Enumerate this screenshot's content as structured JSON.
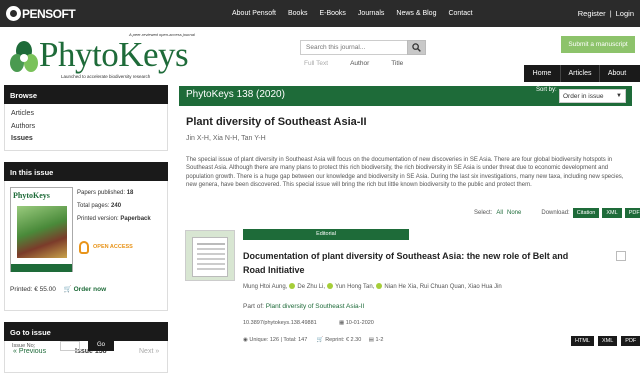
{
  "topbar": {
    "brand": "PENSOFT",
    "nav": [
      "About Pensoft",
      "Books",
      "E-Books",
      "Journals",
      "News & Blog",
      "Contact"
    ],
    "register": "Register",
    "separator": "|",
    "login": "Login"
  },
  "logo": {
    "tagline": "A peer-reviewed open-access journal",
    "name": "PhytoKeys",
    "subtitle": "Launched to accelerate biodiversity research"
  },
  "search": {
    "placeholder": "Search this journal...",
    "options": [
      "Full Text",
      "Author",
      "Title"
    ]
  },
  "submit_label": "Submit a manuscript",
  "mainnav": [
    "Home",
    "Articles",
    "About"
  ],
  "sidebar": {
    "browse_title": "Browse",
    "browse_links": [
      "Articles",
      "Authors",
      "Issues"
    ],
    "issue_title": "In this issue",
    "cover_title": "PhytoKeys",
    "papers_label": "Papers published:",
    "papers_value": "18",
    "pages_label": "Total pages:",
    "pages_value": "240",
    "printed_label": "Printed version:",
    "printed_value": "Paperback",
    "open_access": "OPEN ACCESS",
    "price_label": "Printed: € 55.00",
    "order_label": "Order now",
    "goto_title": "Go to issue",
    "prev": "« Previous",
    "current_issue": "Issue 138",
    "next": "Next »",
    "issue_no_label": "Issue No:",
    "go_label": "Go"
  },
  "main": {
    "issue_heading": "PhytoKeys 138 (2020)",
    "sort_label": "Sort by:",
    "sort_value": "Order in issue",
    "volume_title": "Plant diversity of Southeast Asia-II",
    "editors": "Jin X-H, Xia N-H, Tan Y-H",
    "description": "The special issue of plant diversity in Southeast Asia will focus on the documentation of new discoveries in SE Asia. There are four global biodiversity hotspots in Southeast Asia. Although there are many plans to protect this rich biodiversity, the rich biodiversity in SE Asia is under threat due to economic development and population growth. There is a huge gap between our knowledge and biodiversity in SE Asia. During the last six investigations, many new taxa, including new species, new genera, have been discovered. This special issue will bring the rich but little known biodiversity to the public and protect them.",
    "select_label": "Select:",
    "select_all": "All",
    "select_none": "None",
    "download_label": "Download:",
    "download_buttons": [
      "Citation",
      "XML",
      "PDF"
    ]
  },
  "article": {
    "type_badge": "Editorial",
    "title": "Documentation of plant diversity of Southeast Asia: the new role of Belt and Road Initiative",
    "authors": [
      "Mung Htoi Aung",
      "De Zhu Li",
      "Yun Hong Tan",
      "Nian He Xia",
      "Rui Chuan Quan",
      "Xiao Hua Jin"
    ],
    "part_of_label": "Part of:",
    "part_of": "Plant diversity of Southeast Asia-II",
    "doi": "10.3897/phytokeys.138.49881",
    "date": "10-01-2020",
    "unique": "Unique: 126",
    "total": "Total: 147",
    "reprint": "Reprint: € 2.30",
    "pages": "1-2",
    "formats": [
      "HTML",
      "XML",
      "PDF"
    ]
  }
}
